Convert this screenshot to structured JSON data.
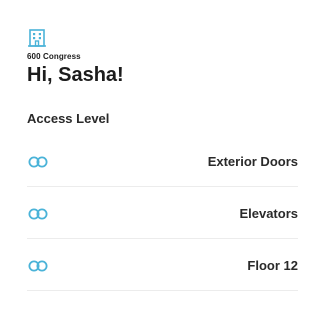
{
  "header": {
    "building_icon": "building-icon",
    "building_name": "600 Congress",
    "greeting": "Hi, Sasha!"
  },
  "access": {
    "title": "Access Level",
    "items": [
      {
        "icon": "link-icon",
        "label": "Exterior Doors"
      },
      {
        "icon": "link-icon",
        "label": "Elevators"
      },
      {
        "icon": "link-icon",
        "label": "Floor 12"
      }
    ]
  },
  "colors": {
    "accent": "#4ab3d8",
    "text": "#1c1c1c",
    "divider": "#ececec"
  }
}
